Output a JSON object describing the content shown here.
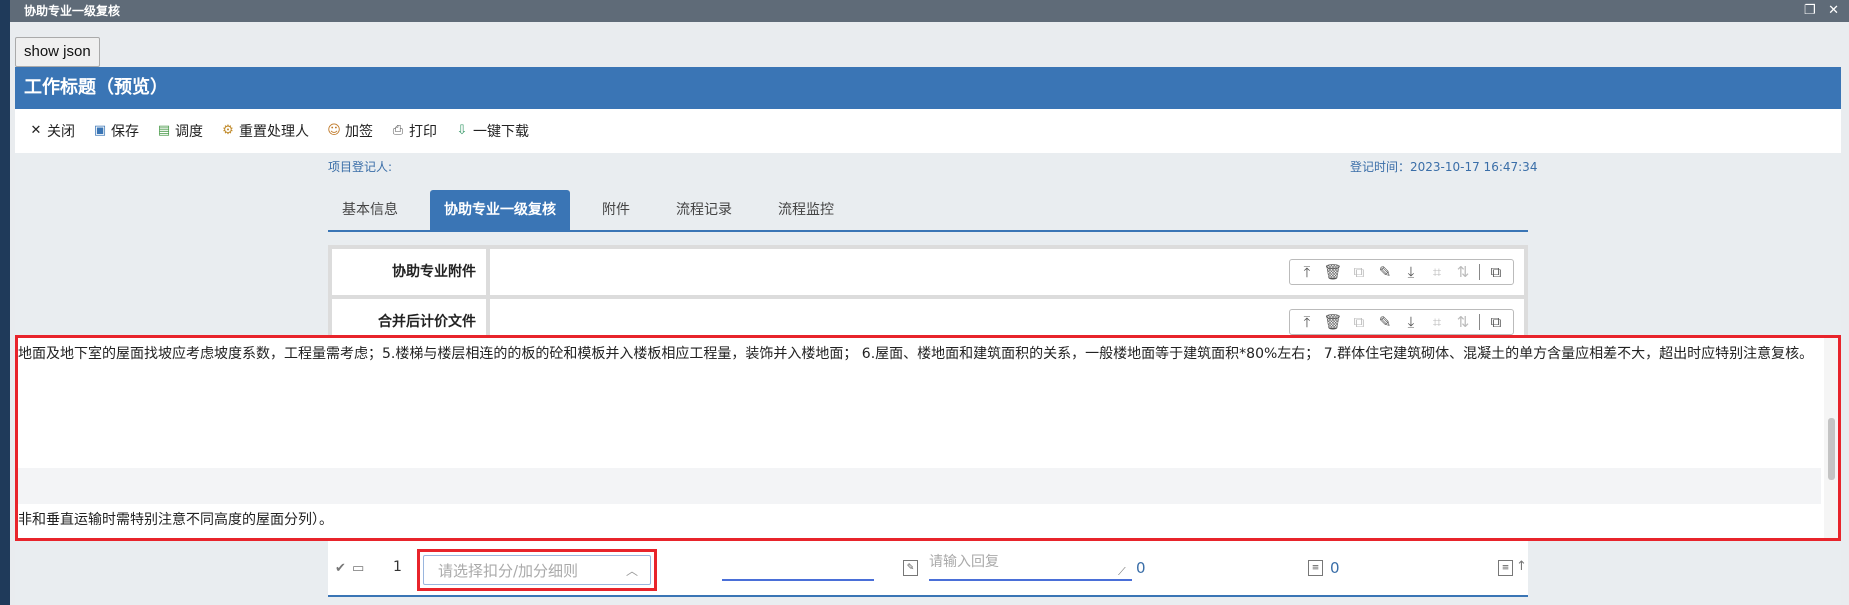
{
  "window": {
    "title": "协助专业一级复核",
    "controls": "❐ ✕"
  },
  "show_json_label": "show json",
  "header": {
    "title": "工作标题（预览）"
  },
  "toolbar": {
    "items": [
      {
        "icon": "✕",
        "label": "关闭"
      },
      {
        "icon": "▣",
        "label": "保存"
      },
      {
        "icon": "▤",
        "label": "调度"
      },
      {
        "icon": "⚙",
        "label": "重置处理人"
      },
      {
        "icon": "☺",
        "label": "加签"
      },
      {
        "icon": "⎙",
        "label": "打印"
      },
      {
        "icon": "⇩",
        "label": "一键下载"
      }
    ]
  },
  "meta": {
    "registrant_label": "项目登记人:",
    "register_time": "登记时间：2023-10-17 16:47:34"
  },
  "tabs": [
    {
      "label": "基本信息",
      "active": false
    },
    {
      "label": "协助专业一级复核",
      "active": true
    },
    {
      "label": "附件",
      "active": false
    },
    {
      "label": "流程记录",
      "active": false
    },
    {
      "label": "流程监控",
      "active": false
    }
  ],
  "form": {
    "rows": [
      {
        "label": "协助专业附件"
      },
      {
        "label": "合并后计价文件"
      }
    ]
  },
  "popup": {
    "line1": "地面及地下室的屋面找坡应考虑坡度系数，工程量需考虑；5.楼梯与楼层相连的的板的砼和模板并入楼板相应工程量，装饰并入楼地面； 6.屋面、楼地面和建筑面积的关系，一般楼地面等于建筑面积*80%左右； 7.群体住宅建筑砌体、混凝土的单方含量应相差不大，超出时应特别注意复核。",
    "line2": "非和垂直运输时需特别注意不同高度的屋面分列）。"
  },
  "bottom_row": {
    "row_number": "1",
    "select_placeholder": "请选择扣分/加分细则",
    "reply_placeholder": "请输入回复",
    "value1": "0",
    "value2": "0"
  }
}
